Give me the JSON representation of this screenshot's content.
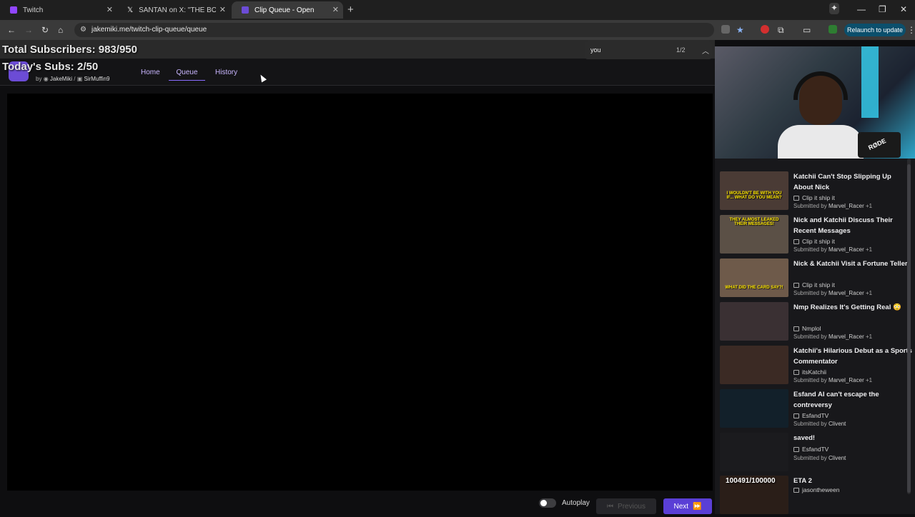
{
  "browser": {
    "tabs": [
      {
        "title": "Twitch",
        "icon": "twitch-icon",
        "color": "#9146ff"
      },
      {
        "title": "SANTAN on X: \"THE BOY WHO",
        "icon": "x-icon",
        "color": "#ffffff"
      },
      {
        "title": "Clip Queue - Open",
        "icon": "clip-queue-icon",
        "color": "#6c4cd6"
      }
    ],
    "url": "jakemiki.me/twitch-clip-queue/queue",
    "relaunch_label": "Relaunch to update"
  },
  "overlay": {
    "total_subs": "Total Subscribers: 983/950",
    "today_subs": "Today's Subs: 2/50"
  },
  "find": {
    "query": "you",
    "count": "1/2"
  },
  "app": {
    "by_label": "by",
    "author1": "JakeMiki",
    "separator": "/",
    "author2": "SirMuffin9",
    "nav": [
      "Home",
      "Queue",
      "History"
    ]
  },
  "clips": [
    {
      "title": "Katchii Can't Stop Slipping Up About Nick",
      "channel": "Clip it ship it",
      "submitted_prefix": "Submitted by",
      "submitter": "Marvel_Racer",
      "extra": "+1",
      "thumb_text": "I wouldn't be with you if... what do you mean?",
      "thumb_color": "#4a3b35"
    },
    {
      "title": "Nick and Katchii Discuss Their Recent Messages",
      "channel": "Clip it ship it",
      "submitted_prefix": "Submitted by",
      "submitter": "Marvel_Racer",
      "extra": "+1",
      "thumb_text": "They almost leaked their messages!",
      "thumb_color": "#5b5046"
    },
    {
      "title": "Nick & Katchii Visit a Fortune Teller",
      "channel": "Clip it ship it",
      "submitted_prefix": "Submitted by",
      "submitter": "Marvel_Racer",
      "extra": "+1",
      "thumb_text": "What did the card say?!",
      "thumb_color": "#6e5a4a"
    },
    {
      "title": "Nmp Realizes It's Getting Real 😳",
      "channel": "Nmplol",
      "submitted_prefix": "Submitted by",
      "submitter": "Marvel_Racer",
      "extra": "+1",
      "thumb_text": "",
      "thumb_color": "#3a3033"
    },
    {
      "title": "Katchii's Hilarious Debut as a Sports Commentator",
      "channel": "itsKatchii",
      "submitted_prefix": "Submitted by",
      "submitter": "Marvel_Racer",
      "extra": "+1",
      "thumb_text": "",
      "thumb_color": "#3b2a24"
    },
    {
      "title": "Esfand AI can't escape the contreversy",
      "channel": "EsfandTV",
      "submitted_prefix": "Submitted by",
      "submitter": "Clivent",
      "extra": "",
      "thumb_text": "",
      "thumb_color": "#12202a"
    },
    {
      "title": "saved!",
      "channel": "EsfandTV",
      "submitted_prefix": "Submitted by",
      "submitter": "Clivent",
      "extra": "",
      "thumb_text": "",
      "thumb_color": "#1b1b1e"
    },
    {
      "title": "ETA 2",
      "channel": "jasontheween",
      "submitted_prefix": "",
      "submitter": "",
      "extra": "",
      "thumb_text": "",
      "thumb_counter": "100491/100000",
      "thumb_color": "#2a1e18"
    }
  ],
  "controls": {
    "autoplay_label": "Autoplay",
    "previous_label": "Previous",
    "next_label": "Next"
  },
  "webcam": {
    "mic_brand": "RØDE"
  }
}
